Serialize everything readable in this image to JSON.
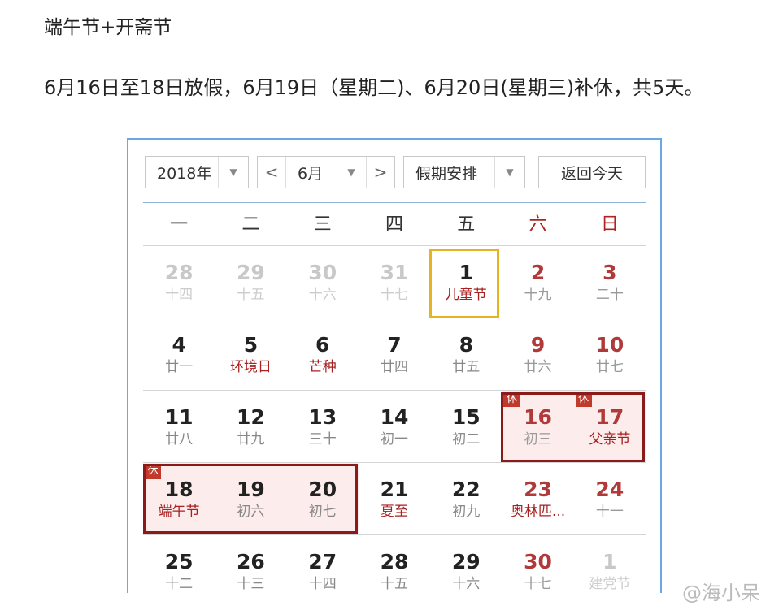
{
  "heading": "端午节+开斋节",
  "notice": "6月16日至18日放假，6月19日（星期二)、6月20日(星期三)补休，共5天。",
  "toolbar": {
    "year": "2018年",
    "prev": "<",
    "month": "6月",
    "next": ">",
    "mode": "假期安排",
    "today_button": "返回今天"
  },
  "weekdays": [
    "一",
    "二",
    "三",
    "四",
    "五",
    "六",
    "日"
  ],
  "weeks": [
    [
      {
        "d": "28",
        "s": "十四",
        "type": "other"
      },
      {
        "d": "29",
        "s": "十五",
        "type": "other"
      },
      {
        "d": "30",
        "s": "十六",
        "type": "other"
      },
      {
        "d": "31",
        "s": "十七",
        "type": "other"
      },
      {
        "d": "1",
        "s": "儿童节",
        "type": "fest"
      },
      {
        "d": "2",
        "s": "十九",
        "type": "we"
      },
      {
        "d": "3",
        "s": "二十",
        "type": "we"
      }
    ],
    [
      {
        "d": "4",
        "s": "廿一",
        "type": ""
      },
      {
        "d": "5",
        "s": "环境日",
        "type": "fest"
      },
      {
        "d": "6",
        "s": "芒种",
        "type": "fest"
      },
      {
        "d": "7",
        "s": "廿四",
        "type": ""
      },
      {
        "d": "8",
        "s": "廿五",
        "type": ""
      },
      {
        "d": "9",
        "s": "廿六",
        "type": "we"
      },
      {
        "d": "10",
        "s": "廿七",
        "type": "we"
      }
    ],
    [
      {
        "d": "11",
        "s": "廿八",
        "type": ""
      },
      {
        "d": "12",
        "s": "廿九",
        "type": ""
      },
      {
        "d": "13",
        "s": "三十",
        "type": ""
      },
      {
        "d": "14",
        "s": "初一",
        "type": ""
      },
      {
        "d": "15",
        "s": "初二",
        "type": ""
      },
      {
        "d": "16",
        "s": "初三",
        "type": "we rest",
        "badge": "休"
      },
      {
        "d": "17",
        "s": "父亲节",
        "type": "we rest fest",
        "badge": "休"
      }
    ],
    [
      {
        "d": "18",
        "s": "端午节",
        "type": "rest fest",
        "badge": "休"
      },
      {
        "d": "19",
        "s": "初六",
        "type": "rest"
      },
      {
        "d": "20",
        "s": "初七",
        "type": "rest"
      },
      {
        "d": "21",
        "s": "夏至",
        "type": "fest"
      },
      {
        "d": "22",
        "s": "初九",
        "type": ""
      },
      {
        "d": "23",
        "s": "奥林匹...",
        "type": "we fest"
      },
      {
        "d": "24",
        "s": "十一",
        "type": "we"
      }
    ],
    [
      {
        "d": "25",
        "s": "十二",
        "type": ""
      },
      {
        "d": "26",
        "s": "十三",
        "type": ""
      },
      {
        "d": "27",
        "s": "十四",
        "type": ""
      },
      {
        "d": "28",
        "s": "十五",
        "type": ""
      },
      {
        "d": "29",
        "s": "十六",
        "type": ""
      },
      {
        "d": "30",
        "s": "十七",
        "type": "we"
      },
      {
        "d": "1",
        "s": "建党节",
        "type": "other"
      }
    ]
  ],
  "watermark": "@海小呆",
  "colors": {
    "today_border": "#e6b422",
    "rest_border": "#8b1a1a",
    "weekend": "#b03a3a",
    "calendar_border": "#6aa8e0"
  }
}
